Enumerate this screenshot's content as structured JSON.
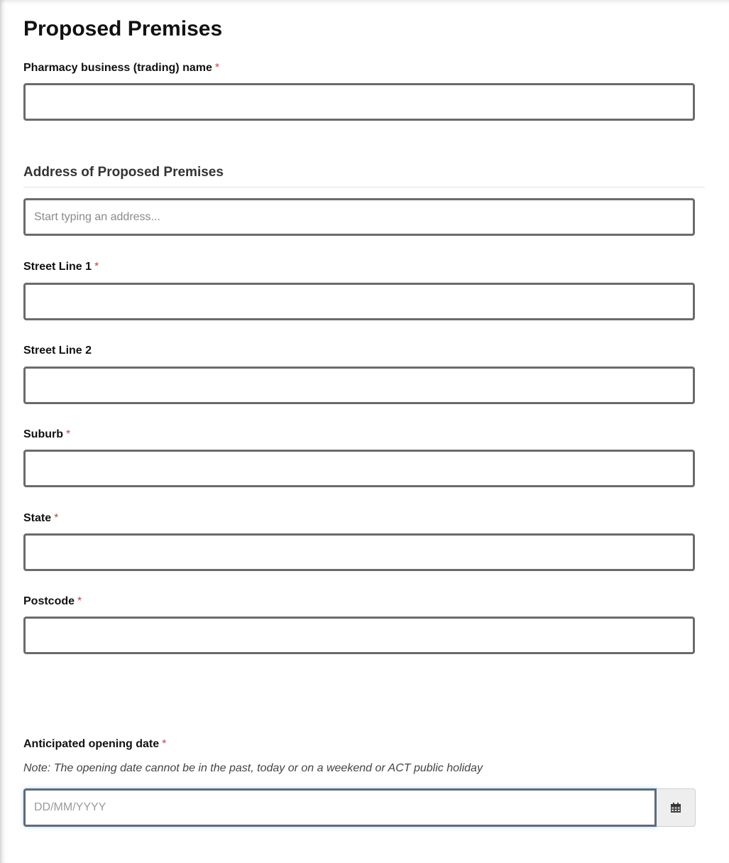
{
  "page": {
    "title": "Proposed Premises"
  },
  "fields": {
    "trading_name": {
      "label": "Pharmacy business (trading) name",
      "required_mark": "*",
      "value": ""
    },
    "address_heading": "Address of Proposed Premises",
    "address_search": {
      "placeholder": "Start typing an address...",
      "value": ""
    },
    "street_line_1": {
      "label": "Street Line 1",
      "required_mark": "*",
      "value": ""
    },
    "street_line_2": {
      "label": "Street Line 2",
      "value": ""
    },
    "suburb": {
      "label": "Suburb",
      "required_mark": "*",
      "value": ""
    },
    "state": {
      "label": "State",
      "required_mark": "*",
      "value": ""
    },
    "postcode": {
      "label": "Postcode",
      "required_mark": "*",
      "value": ""
    },
    "opening_date": {
      "label": "Anticipated opening date",
      "required_mark": "*",
      "note": "Note: The opening date cannot be in the past, today or on a weekend or ACT public holiday",
      "placeholder": "DD/MM/YYYY",
      "value": "",
      "button_icon": "calendar-icon"
    }
  },
  "colors": {
    "required": "#b94a48",
    "input_border": "#6b6b6b",
    "focus_border": "#5f6b78"
  }
}
